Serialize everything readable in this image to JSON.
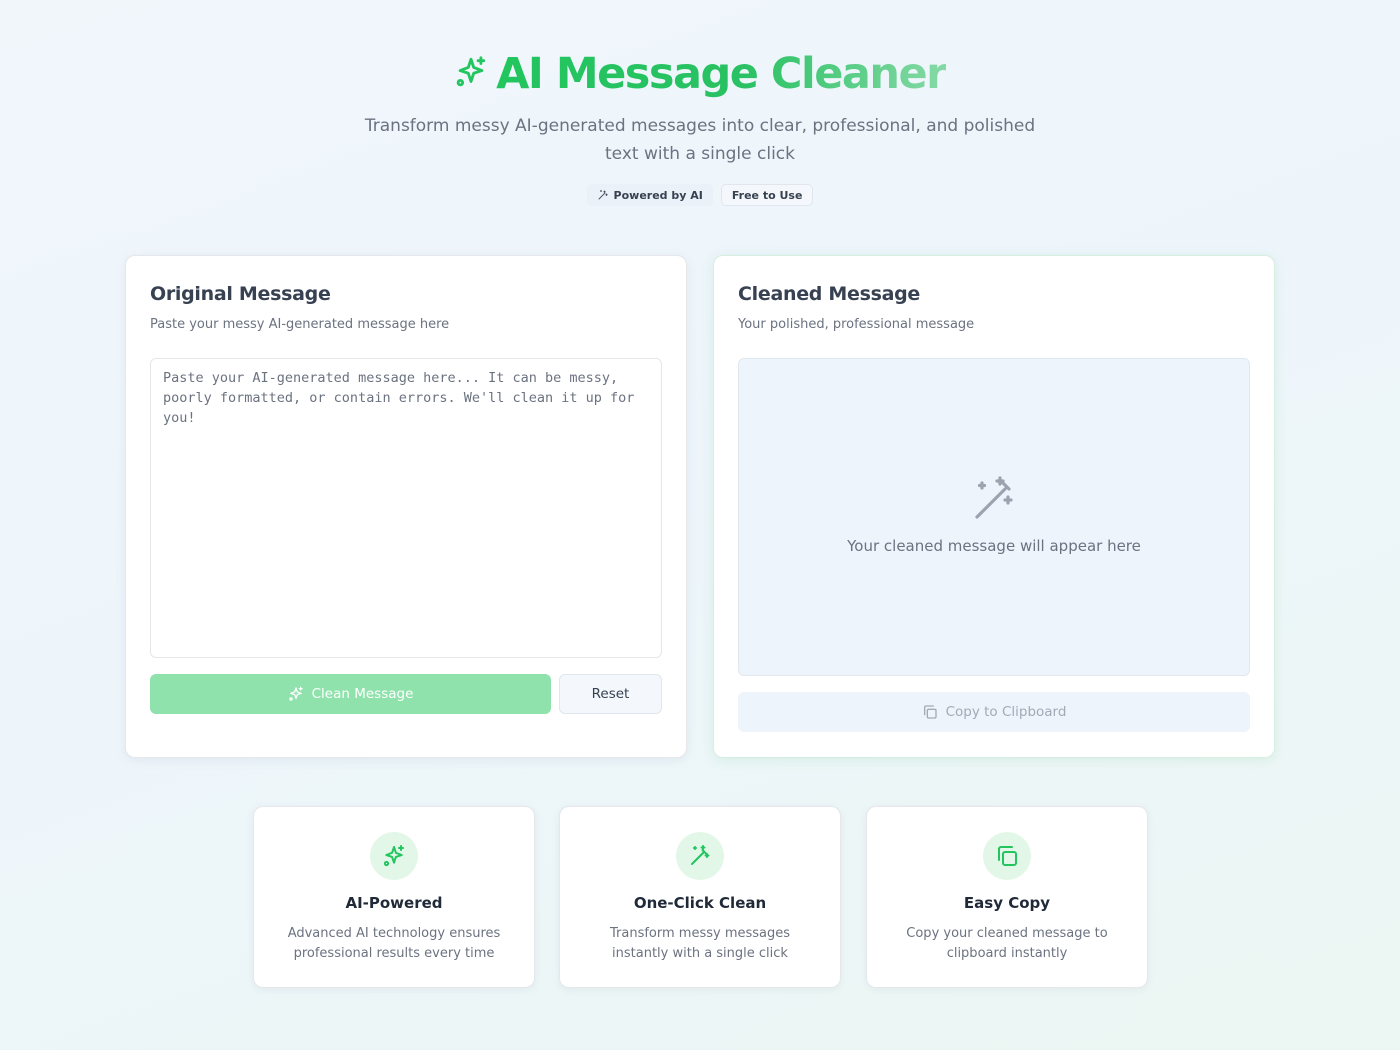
{
  "header": {
    "title": "AI Message Cleaner",
    "subtitle": "Transform messy AI-generated messages into clear, professional, and polished text with a single click",
    "badges": [
      {
        "label": "Powered by AI",
        "icon": "wand-icon"
      },
      {
        "label": "Free to Use"
      }
    ]
  },
  "original": {
    "title": "Original Message",
    "description": "Paste your messy AI-generated message here",
    "value": "",
    "placeholder": "Paste your AI-generated message here... It can be messy, poorly formatted, or contain errors. We'll clean it up for you!",
    "clean_label": "Clean Message",
    "reset_label": "Reset"
  },
  "cleaned": {
    "title": "Cleaned Message",
    "description": "Your polished, professional message",
    "empty_text": "Your cleaned message will appear here",
    "copy_label": "Copy to Clipboard"
  },
  "features": [
    {
      "title": "AI-Powered",
      "description": "Advanced AI technology ensures professional results every time",
      "icon": "sparkles-icon"
    },
    {
      "title": "One-Click Clean",
      "description": "Transform messy messages instantly with a single click",
      "icon": "wand-icon"
    },
    {
      "title": "Easy Copy",
      "description": "Copy your cleaned message to clipboard instantly",
      "icon": "copy-icon"
    }
  ],
  "colors": {
    "accent": "#22c55e",
    "accent_disabled": "#8fe2ab",
    "text": "#374151",
    "muted": "#6b7280"
  }
}
